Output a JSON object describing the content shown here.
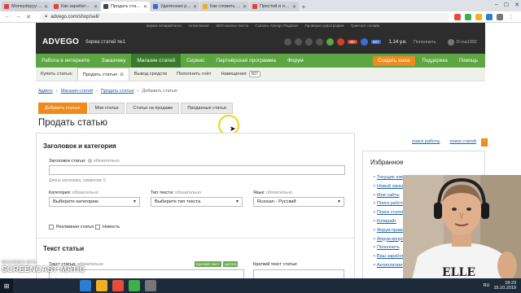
{
  "browser": {
    "tabs": [
      {
        "label": "Moneydayyy: Топ 200 с",
        "color": "#e04040",
        "active": false
      },
      {
        "label": "Как зарабатывать день",
        "color": "#e04040",
        "active": false
      },
      {
        "label": "Продать статью на бир",
        "color": "#444444",
        "active": true
      },
      {
        "label": "Удаленная работа по р",
        "color": "#3d6bd6",
        "active": false
      },
      {
        "label": "Как словить рыбу — Я",
        "color": "#e8b020",
        "active": false
      },
      {
        "label": "Простой и легальный",
        "color": "#e04040",
        "active": false
      }
    ],
    "url": "advego.com/shop/sell/",
    "window_controls": [
      "–",
      "☐",
      "✕"
    ]
  },
  "site": {
    "logo": "ADVEGO",
    "slogan": "биржа статей №1",
    "top_links": [
      "Биржа копирайтинга",
      "Антиплагиат",
      "SEO-анализ текста",
      "Скачать Advego Plagiatus",
      "Проверка орфографии",
      "Транслит онлайн"
    ],
    "badges": [
      "99+",
      "507"
    ],
    "balance": "1.14 у.е.",
    "topup": "Пополнить",
    "username": "D-ina1992"
  },
  "main_nav": {
    "items": [
      "Работа в интернете",
      "Заказчику",
      "Магазин статей",
      "Сервис",
      "Партнёрская программа",
      "Форум"
    ],
    "active": "Магазин статей",
    "create_order": "Создать заказ",
    "support": "Поддержка",
    "help": "Помощь"
  },
  "sub_nav": {
    "items": [
      "Купить статью",
      "Продать статью",
      "Вывод средств",
      "Пополнить счёт",
      "Навещения"
    ],
    "badge": "507",
    "active": "Продать статью"
  },
  "breadcrumb": [
    "Адвего",
    "Магазин статей",
    "Продать статью",
    "Добавить статью"
  ],
  "page_tabs": [
    "Добавить статью",
    "Мои статьи",
    "Статьи на продаже",
    "Проданные статьи"
  ],
  "page_title": "Продать статью",
  "links_right": [
    "поиск работы",
    "поиск статей"
  ],
  "form": {
    "section1": "Заголовок и категория",
    "title_label": "Заголовок статьи:",
    "title_required": "обязательно",
    "title_hint": "Длина заголовка, символов: 0",
    "category_label": "Категория:",
    "category_value": "Выберите категорию",
    "text_type_label": "Тип текста:",
    "text_type_value": "Выберите тип текста",
    "language_label": "Язык:",
    "language_value": "Russian - Русский",
    "required": "обязательно",
    "checkbox_ad": "Рекламная статья",
    "checkbox_news": "Новость",
    "section2": "Текст статьи",
    "article_text_label": "Текст статьи:",
    "short_text_label": "Краткий текст статьи:",
    "tag1": "Краткий текст",
    "tag2": "Цитата"
  },
  "sidebar": {
    "title": "Избранное",
    "items": [
      "Текущие извещения",
      "Новый заказ",
      "Мои сайты",
      "Поиск работы",
      "Поиск статей",
      "Копирайт",
      "Форум правил",
      "Форум вопросы",
      "Пополнить",
      "Ваш заработок",
      "Антиплагиат"
    ]
  },
  "taskbar": {
    "time": "18:23",
    "date": "15.10.2019",
    "lang": "RU"
  },
  "watermark": {
    "line1": "SCREENCAST",
    "line2": "MATIC",
    "recorded": "RECORDED WITH"
  }
}
